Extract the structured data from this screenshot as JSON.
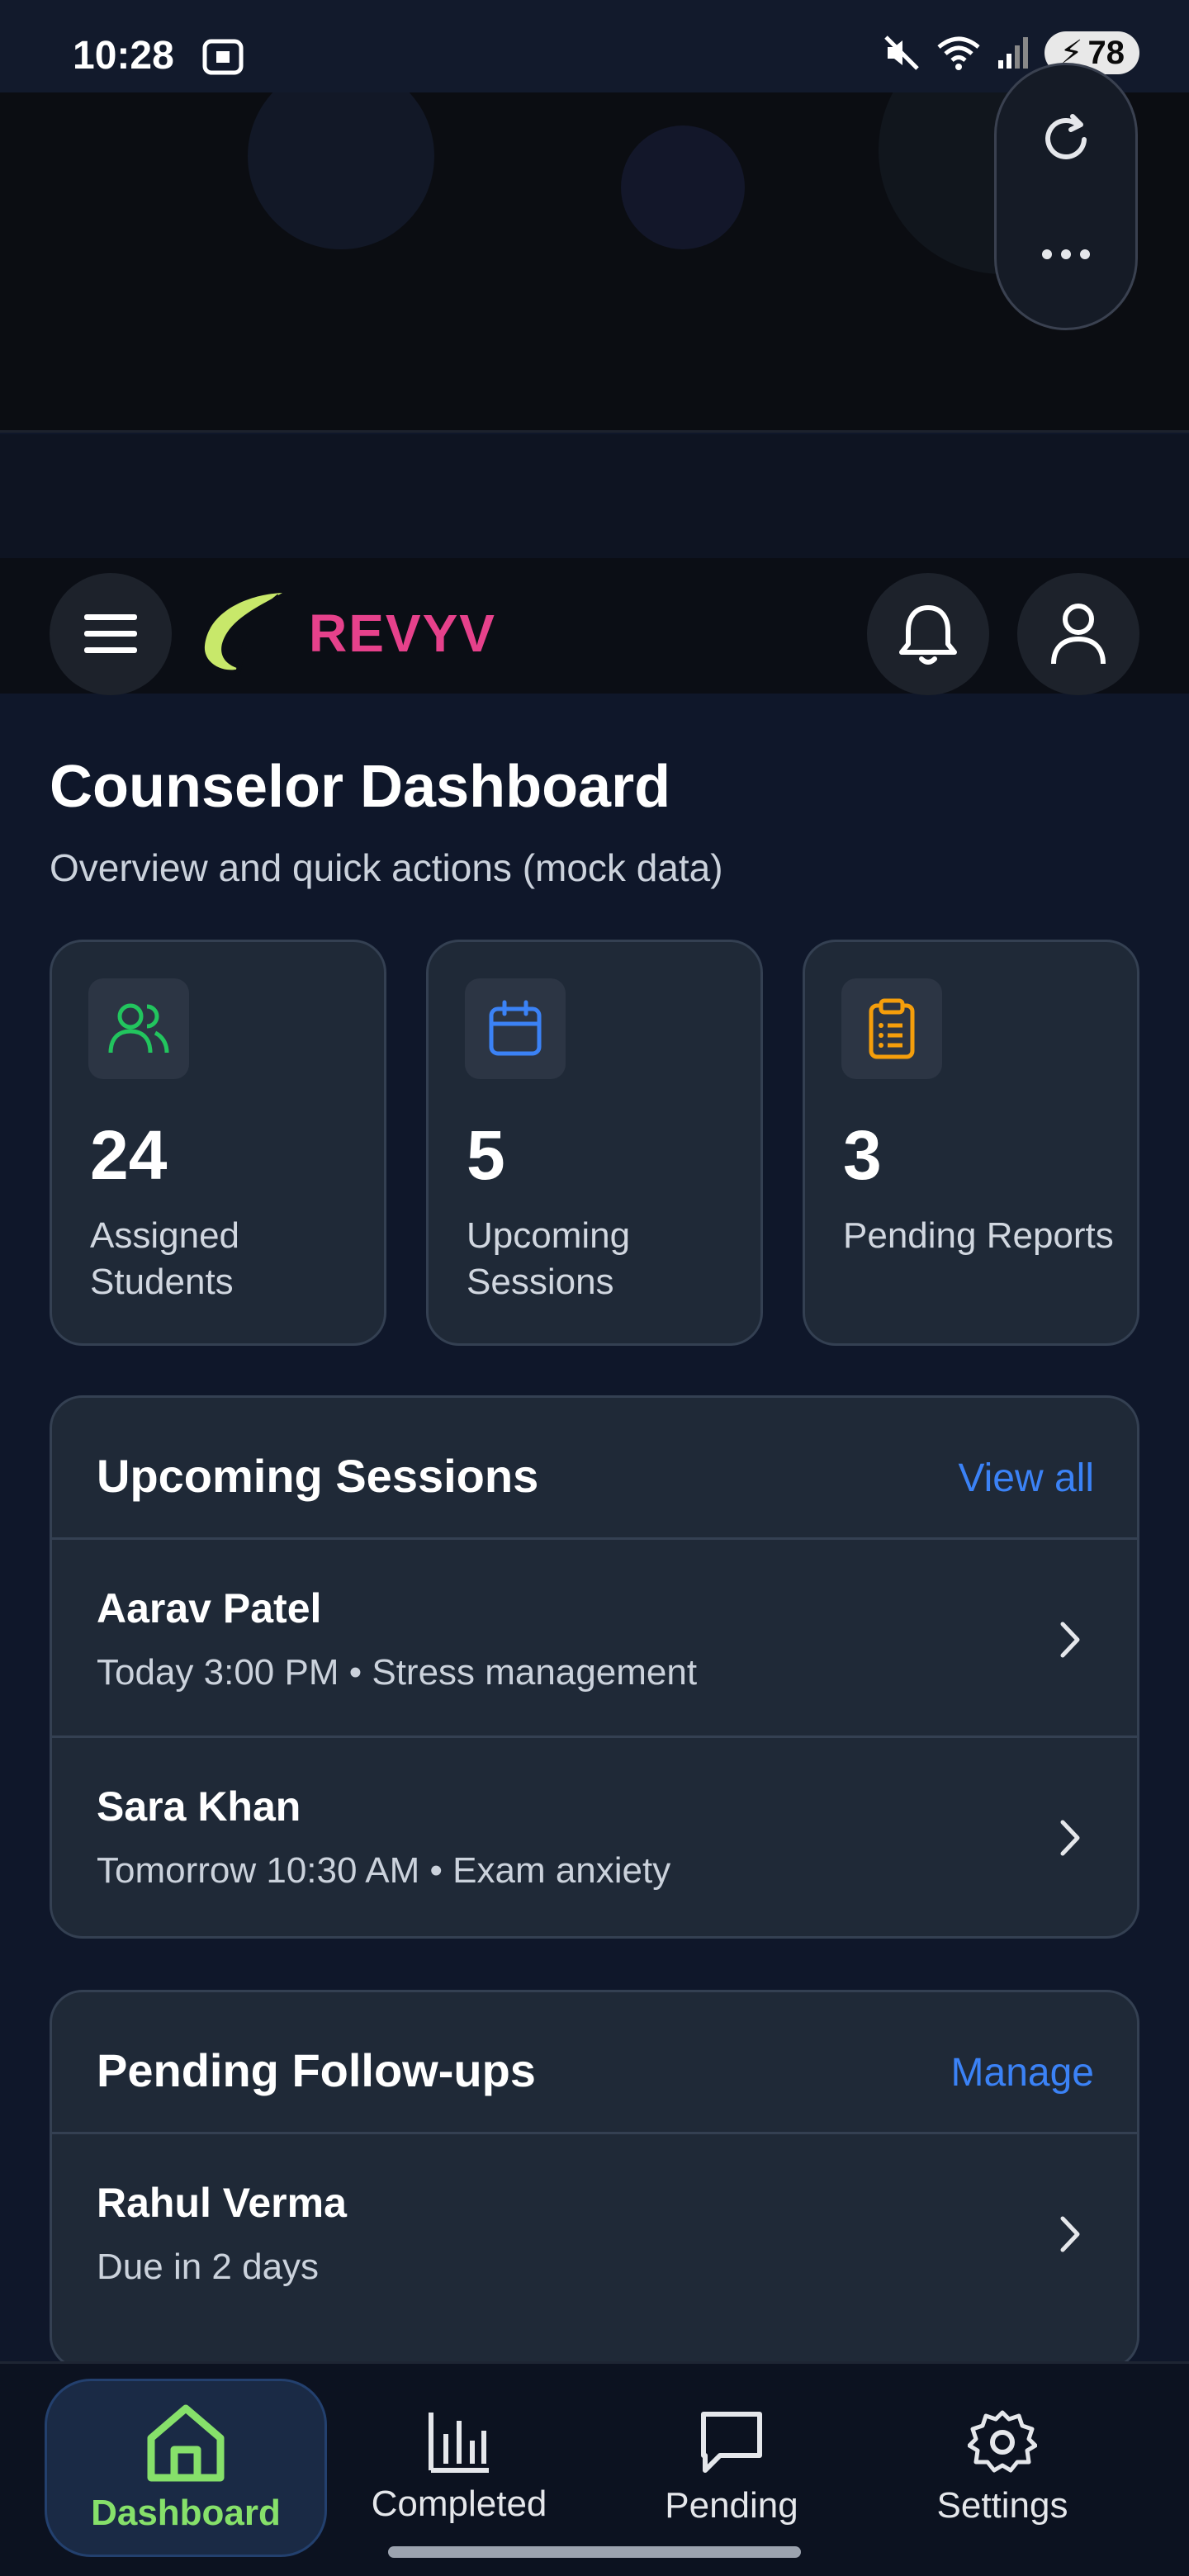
{
  "status_bar": {
    "time": "10:28",
    "battery": "78"
  },
  "header": {
    "brand": "REVYV"
  },
  "dashboard": {
    "title": "Counselor Dashboard",
    "subtitle": "Overview and quick actions (mock data)",
    "stats": [
      {
        "value": "24",
        "label": "Assigned Students",
        "icon": "users-icon",
        "color": "#22c55e"
      },
      {
        "value": "5",
        "label": "Upcoming Sessions",
        "icon": "calendar-icon",
        "color": "#3b82f6"
      },
      {
        "value": "3",
        "label": "Pending Reports",
        "icon": "clipboard-icon",
        "color": "#f59e0b"
      }
    ]
  },
  "upcoming": {
    "title": "Upcoming Sessions",
    "link": "View all",
    "items": [
      {
        "name": "Aarav Patel",
        "detail": "Today 3:00 PM • Stress management"
      },
      {
        "name": "Sara Khan",
        "detail": "Tomorrow 10:30 AM • Exam anxiety"
      }
    ]
  },
  "followups": {
    "title": "Pending Follow-ups",
    "link": "Manage",
    "items": [
      {
        "name": "Rahul Verma",
        "detail": "Due in 2 days"
      }
    ]
  },
  "nav": {
    "items": [
      {
        "label": "Dashboard",
        "icon": "home-icon"
      },
      {
        "label": "Completed",
        "icon": "bar-chart-icon"
      },
      {
        "label": "Pending",
        "icon": "message-icon"
      },
      {
        "label": "Settings",
        "icon": "gear-icon"
      }
    ],
    "active": "Dashboard"
  },
  "colors": {
    "accent": "#3b82f6",
    "brand": "#e6418b",
    "active_nav": "#86e06a"
  }
}
